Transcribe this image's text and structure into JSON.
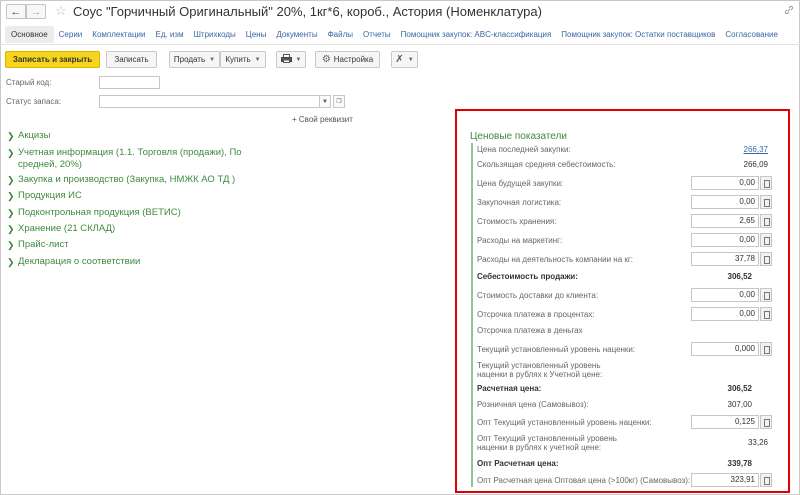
{
  "window": {
    "title": "Соус \"Горчичный Оригинальный\" 20%, 1кг*6, короб., Астория (Номенклатура)",
    "back_icon": "←",
    "forward_icon": "→",
    "star_icon": "☆",
    "link_icon": "🔗"
  },
  "tabs": [
    "Основное",
    "Серии",
    "Комплектации",
    "Ед. изм",
    "Штрихкоды",
    "Цены",
    "Документы",
    "Файлы",
    "Отчеты",
    "Помощник закупок: ABC-классификация",
    "Помощник закупок: Остатки поставщиков",
    "Согласование"
  ],
  "toolbar": {
    "save_close": "Записать и закрыть",
    "save": "Записать",
    "sell": "Продать",
    "buy": "Купить",
    "settings": "Настройка"
  },
  "fields": {
    "old_code_label": "Старый код:",
    "stock_status_label": "Статус запаса:",
    "add_requisite": "+ Свой реквизит"
  },
  "groups": [
    "Акцизы",
    "Учетная информация (1.1. Торговля (продажи), По средней, 20%)",
    "Закупка и производство (Закупка, НМЖК АО ТД )",
    "Продукция ИС",
    "Подконтрольная продукция (ВЕТИС)",
    "Хранение (21 СКЛАД)",
    "Прайс-лист",
    "Декларация о соответствии"
  ],
  "groups_wrapped": {
    "line1": "Учетная информация (1.1. Торговля (продажи), По",
    "line2": "средней, 20%)"
  },
  "prices": {
    "title": "Ценовые показатели",
    "rows": [
      {
        "label": "Цена последней закупки:",
        "value": "266,37"
      },
      {
        "label": "Скользящая средняя себестоимость:",
        "value": "266,09"
      },
      {
        "label": "Цена будущей закупки:",
        "value": "0,00"
      },
      {
        "label": "Закупочная логистика:",
        "value": "0,00"
      },
      {
        "label": "Стоимость хранения:",
        "value": "2,65"
      },
      {
        "label": "Расходы на маркетинг:",
        "value": "0,00"
      },
      {
        "label": "Расходы на деятельность компании на кг:",
        "value": "37,78"
      },
      {
        "label": "Себестоимость продажи:",
        "value": "306,52"
      },
      {
        "label": "Стоимость доставки до клиента:",
        "value": "0,00"
      },
      {
        "label": "Отсрочка платежа в процентах:",
        "value": "0,00"
      },
      {
        "label": "Отсрочка платежа в деньгах",
        "value": ""
      },
      {
        "label": "Текущий установленный уровень наценки:",
        "value": "0,000"
      },
      {
        "label1": "Текущий установленный уровень",
        "label2": "наценки в рублях к Учетной цене:",
        "value": ""
      },
      {
        "label": "Расчетная цена:",
        "value": "306,52"
      },
      {
        "label": "Розничная цена (Самовывоз):",
        "value": "307,00"
      },
      {
        "label": "Опт Текущий установленный уровень наценки:",
        "value": "0,125"
      },
      {
        "label1": "Опт Текущий установленный уровень",
        "label2": "наценки в рублях к учетной цене:",
        "value": "33,26"
      },
      {
        "label": "Опт Расчетная цена:",
        "value": "339,78"
      },
      {
        "label": "Опт Расчетная цена Оптовая цена (>100кг) (Самовывоз):",
        "value": "323,91"
      }
    ]
  }
}
